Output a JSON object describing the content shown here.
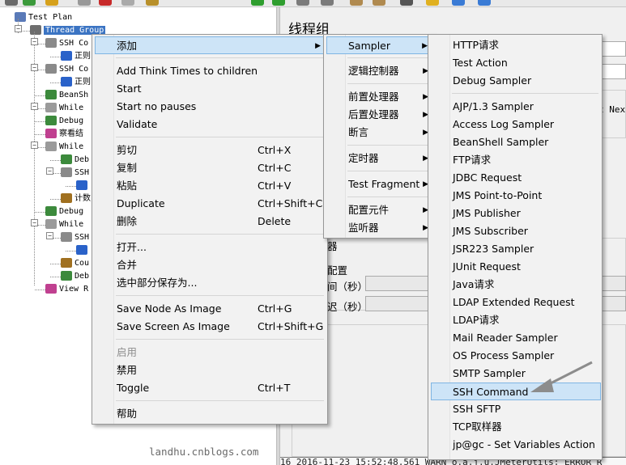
{
  "tree": {
    "nodes": [
      {
        "label": "Test Plan",
        "indent": 0,
        "icon": "test-plan-icon"
      },
      {
        "label": "Thread Group",
        "indent": 1,
        "icon": "thread-group-gear-icon",
        "selected": true
      },
      {
        "label": "SSH Co",
        "indent": 2,
        "icon": "ssh-sampler-icon"
      },
      {
        "label": "正则",
        "indent": 3,
        "icon": "extractor-icon"
      },
      {
        "label": "SSH Co",
        "indent": 2,
        "icon": "ssh-sampler-icon"
      },
      {
        "label": "正则",
        "indent": 3,
        "icon": "extractor-icon"
      },
      {
        "label": "BeanSh",
        "indent": 2,
        "icon": "beanshell-sampler-icon"
      },
      {
        "label": "While",
        "indent": 2,
        "icon": "while-controller-icon"
      },
      {
        "label": "Debug",
        "indent": 2,
        "icon": "debug-sampler-icon"
      },
      {
        "label": "察看结",
        "indent": 2,
        "icon": "listener-icon"
      },
      {
        "label": "While",
        "indent": 2,
        "icon": "while-controller-icon"
      },
      {
        "label": "Deb",
        "indent": 3,
        "icon": "debug-sampler-icon"
      },
      {
        "label": "SSH",
        "indent": 3,
        "icon": "ssh-sampler-icon"
      },
      {
        "label": "",
        "indent": 4,
        "icon": "extractor-icon"
      },
      {
        "label": "计数",
        "indent": 3,
        "icon": "counter-icon"
      },
      {
        "label": "Debug",
        "indent": 2,
        "icon": "debug-sampler-icon"
      },
      {
        "label": "While",
        "indent": 2,
        "icon": "while-controller-icon"
      },
      {
        "label": "SSH",
        "indent": 3,
        "icon": "ssh-sampler-icon"
      },
      {
        "label": "",
        "indent": 4,
        "icon": "extractor-icon"
      },
      {
        "label": "Cou",
        "indent": 3,
        "icon": "counter-icon"
      },
      {
        "label": "Deb",
        "indent": 3,
        "icon": "debug-sampler-icon"
      },
      {
        "label": "View R",
        "indent": 2,
        "icon": "listener-icon"
      }
    ]
  },
  "panel": {
    "title": "线程组",
    "partial_text_1": "器",
    "partial_text_2": "配置",
    "partial_text_3": "间（秒）",
    "partial_text_4": "迟（秒）",
    "partial_text_right": "t Nex"
  },
  "context_menu": {
    "groups": [
      [
        {
          "label": "添加",
          "accel": "",
          "submenu": true,
          "highlighted": true
        }
      ],
      [
        {
          "label": "Add Think Times to children",
          "accel": ""
        },
        {
          "label": "Start",
          "accel": ""
        },
        {
          "label": "Start no pauses",
          "accel": ""
        },
        {
          "label": "Validate",
          "accel": ""
        }
      ],
      [
        {
          "label": "剪切",
          "accel": "Ctrl+X"
        },
        {
          "label": "复制",
          "accel": "Ctrl+C"
        },
        {
          "label": "粘贴",
          "accel": "Ctrl+V"
        },
        {
          "label": "Duplicate",
          "accel": "Ctrl+Shift+C"
        },
        {
          "label": "删除",
          "accel": "Delete"
        }
      ],
      [
        {
          "label": "打开...",
          "accel": ""
        },
        {
          "label": "合并",
          "accel": ""
        },
        {
          "label": "选中部分保存为...",
          "accel": ""
        }
      ],
      [
        {
          "label": "Save Node As Image",
          "accel": "Ctrl+G"
        },
        {
          "label": "Save Screen As Image",
          "accel": "Ctrl+Shift+G"
        }
      ],
      [
        {
          "label": "启用",
          "accel": "",
          "disabled": true
        },
        {
          "label": "禁用",
          "accel": ""
        },
        {
          "label": "Toggle",
          "accel": "Ctrl+T"
        }
      ],
      [
        {
          "label": "帮助",
          "accel": ""
        }
      ]
    ]
  },
  "add_submenu": {
    "groups": [
      [
        {
          "label": "Sampler",
          "submenu": true,
          "highlighted": true
        }
      ],
      [
        {
          "label": "逻辑控制器",
          "submenu": true
        }
      ],
      [
        {
          "label": "前置处理器",
          "submenu": true
        },
        {
          "label": "后置处理器",
          "submenu": true
        },
        {
          "label": "断言",
          "submenu": true
        }
      ],
      [
        {
          "label": "定时器",
          "submenu": true
        }
      ],
      [
        {
          "label": "Test Fragment",
          "submenu": true
        }
      ],
      [
        {
          "label": "配置元件",
          "submenu": true
        },
        {
          "label": "监听器",
          "submenu": true
        }
      ]
    ]
  },
  "sampler_submenu": {
    "groups": [
      [
        {
          "label": "HTTP请求"
        },
        {
          "label": "Test Action"
        },
        {
          "label": "Debug Sampler"
        }
      ],
      [
        {
          "label": "AJP/1.3 Sampler"
        },
        {
          "label": "Access Log Sampler"
        },
        {
          "label": "BeanShell Sampler"
        },
        {
          "label": "FTP请求"
        },
        {
          "label": "JDBC Request"
        },
        {
          "label": "JMS Point-to-Point"
        },
        {
          "label": "JMS Publisher"
        },
        {
          "label": "JMS Subscriber"
        },
        {
          "label": "JSR223 Sampler"
        },
        {
          "label": "JUnit Request"
        },
        {
          "label": "Java请求"
        },
        {
          "label": "LDAP Extended Request"
        },
        {
          "label": "LDAP请求"
        },
        {
          "label": "Mail Reader Sampler"
        },
        {
          "label": "OS Process Sampler"
        },
        {
          "label": "SMTP Sampler"
        },
        {
          "label": "SSH Command",
          "highlighted": true
        },
        {
          "label": "SSH SFTP"
        },
        {
          "label": "TCP取样器"
        },
        {
          "label": "jp@gc - Set Variables Action"
        }
      ]
    ]
  },
  "watermark": "landhu.cnblogs.com",
  "status_line": "16 2016-11-23 15:52:48,561 WARN o.a.j.u.JMeterUtils: ERROR R",
  "colors": {
    "highlight_bg": "#cde4f7",
    "highlight_border": "#7fb5e3",
    "selected_node": "#3b74c3",
    "menu_bg": "#f2f2f2",
    "arrow": "#8c8c8c"
  }
}
